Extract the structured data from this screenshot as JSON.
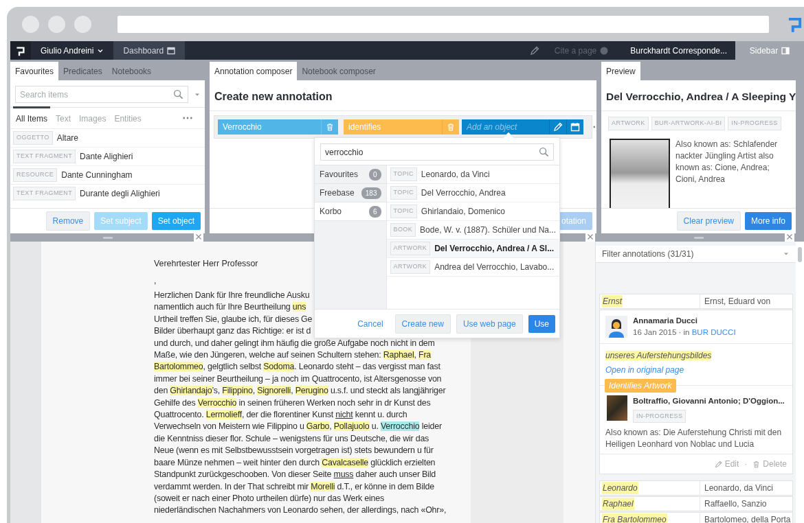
{
  "navbar": {
    "user": "Giulio Andreini",
    "dashboard": "Dashboard",
    "cite": {
      "label": "Cite a page",
      "disabled": true
    },
    "document": "Burckhardt Corresponde...",
    "sidebar": "Sidebar"
  },
  "left_panel": {
    "tabs": [
      {
        "label": "Favourites",
        "selected": true
      },
      {
        "label": "Predicates",
        "selected": false
      },
      {
        "label": "Notebooks",
        "selected": false
      }
    ],
    "search": {
      "placeholder": "Search items"
    },
    "filters": [
      {
        "label": "All Items",
        "selected": true
      },
      {
        "label": "Text",
        "selected": false
      },
      {
        "label": "Images",
        "selected": false
      },
      {
        "label": "Entities",
        "selected": false
      }
    ],
    "items": [
      {
        "type": "OGGETTO",
        "label": "Altare"
      },
      {
        "type": "TEXT FRAGMENT",
        "label": "Dante Alighieri"
      },
      {
        "type": "RESOURCE",
        "label": "Dante Cunningham"
      },
      {
        "type": "TEXT FRAGMENT",
        "label": "Durante degli Alighieri"
      }
    ],
    "buttons": [
      {
        "label": "Remove",
        "kind": "default",
        "disabled": false
      },
      {
        "label": "Set subject",
        "kind": "bright",
        "disabled": true
      },
      {
        "label": "Set object",
        "kind": "bright",
        "disabled": false
      }
    ]
  },
  "composer": {
    "tabs": [
      {
        "label": "Annotation composer",
        "selected": true
      },
      {
        "label": "Notebook composer",
        "selected": false
      }
    ],
    "title": "Create new annotation",
    "subject": "Verrocchio",
    "predicate": "identifies",
    "object": {
      "placeholder": "Add an object"
    },
    "button": "otation"
  },
  "preview": {
    "tabs": [
      {
        "label": "Preview",
        "selected": true
      }
    ],
    "title": "Del Verrocchio, Andrea / A Sleeping Y",
    "tags": [
      "ARTWORK",
      "BUR-ARTWORK-AI-BI",
      "IN-PROGRESS"
    ],
    "description": "Also known as: Schlafender nackter Jüngling Artist also known as: Cione, Andrea; Cioni, Andrea",
    "buttons": [
      {
        "label": "Clear preview",
        "kind": "default",
        "disabled": false
      },
      {
        "label": "More info",
        "kind": "primary",
        "disabled": false
      }
    ]
  },
  "letter": {
    "salutation": "Verehrtester Herr Professor",
    "comma": ",",
    "lines": [
      [
        {
          "kind": "plain",
          "text": "Herzlichen Dank für Ihre freundliche Ausku"
        }
      ],
      [
        {
          "kind": "plain",
          "text": "namentlich auch für Ihre Beurtheilung "
        },
        {
          "kind": "highlight",
          "text": "uns",
          "color": "#fcf7a5"
        }
      ],
      [
        {
          "kind": "plain",
          "text": "Urtheil treffen Sie, glaube ich, für dieses Ge"
        }
      ],
      [
        {
          "kind": "plain",
          "text": "Bilder überhaupt ganz das Richtige: er ist d"
        }
      ],
      [
        {
          "kind": "plain",
          "text": "und durch, und daher gelingt ihm häufig die große Aufgabe noch nicht in dem"
        }
      ],
      [
        {
          "kind": "plain",
          "text": "Maße, wie den Jüngeren, welche auf seinen Schultern stehen: "
        },
        {
          "kind": "highlight",
          "text": "Raphael",
          "color": "#fcf7a5"
        },
        {
          "kind": "plain",
          "text": ", "
        },
        {
          "kind": "highlight",
          "text": "Fra",
          "color": "#fcf7a5"
        }
      ],
      [
        {
          "kind": "highlight",
          "text": "Bartolommeo",
          "color": "#fcf7a5"
        },
        {
          "kind": "plain",
          "text": ", gelgtlich selbst "
        },
        {
          "kind": "highlight",
          "text": "Sodoma",
          "color": "#fcf7a5"
        },
        {
          "kind": "plain",
          "text": ". Leonardo steht – das vergisst man fast"
        }
      ],
      [
        {
          "kind": "plain",
          "text": "immer bei seiner Beurtheilung – ja noch im Quattrocento, ist Altersgenosse von"
        }
      ],
      [
        {
          "kind": "plain",
          "text": "den "
        },
        {
          "kind": "highlight",
          "text": "Ghirlandajo",
          "color": "#fcf7a5"
        },
        {
          "kind": "plain",
          "text": "’s, "
        },
        {
          "kind": "highlight",
          "text": "Filippino",
          "color": "#fcf7a5"
        },
        {
          "kind": "plain",
          "text": ", "
        },
        {
          "kind": "highlight",
          "text": "Signorelli",
          "color": "#fcf7a5"
        },
        {
          "kind": "plain",
          "text": ", "
        },
        {
          "kind": "highlight",
          "text": "Perugino",
          "color": "#fcf7a5"
        },
        {
          "kind": "plain",
          "text": " u.s.f. und steckt als langjähriger"
        }
      ],
      [
        {
          "kind": "plain",
          "text": "Gehilfe des "
        },
        {
          "kind": "highlight",
          "text": "Verrocchio",
          "color": "#fcf7a5"
        },
        {
          "kind": "plain",
          "text": " in seinen früheren Werken noch sehr in dr Kunst des"
        }
      ],
      [
        {
          "kind": "plain",
          "text": "Quattrocento. "
        },
        {
          "kind": "highlight",
          "text": "Lermolieff",
          "color": "#fcf7a5"
        },
        {
          "kind": "plain",
          "text": ", der die florentiner Kunst "
        },
        {
          "kind": "underline",
          "text": "nicht"
        },
        {
          "kind": "plain",
          "text": " kennt u. durch"
        }
      ],
      [
        {
          "kind": "plain",
          "text": "Verwechseln von Meistern wie Filippino u "
        },
        {
          "kind": "highlight",
          "text": "Garbo",
          "color": "#fcf7a5"
        },
        {
          "kind": "plain",
          "text": ", "
        },
        {
          "kind": "highlight",
          "text": "Pollajuolo",
          "color": "#fcf7a5"
        },
        {
          "kind": "plain",
          "text": " u. "
        },
        {
          "kind": "highlight",
          "text": "Verrocchio",
          "color": "#a6ecec"
        },
        {
          "kind": "plain",
          "text": " leider"
        }
      ],
      [
        {
          "kind": "plain",
          "text": "die Kenntniss dieser flor. Schule – wenigstens für uns Deutsche, die wir das"
        }
      ],
      [
        {
          "kind": "plain",
          "text": "Neue (wenn es mit Selbstbewusstsein vorgetragen ist) stets bewundern u für"
        }
      ],
      [
        {
          "kind": "plain",
          "text": "baare Münze nehmen – weit hinter den durch "
        },
        {
          "kind": "highlight",
          "text": "Cavalcaselle",
          "color": "#fcf7a5"
        },
        {
          "kind": "plain",
          "text": " glücklich erzielten"
        }
      ],
      [
        {
          "kind": "plain",
          "text": "Standpunkt zurückgeschooben. Von dieser Seite "
        },
        {
          "kind": "underline",
          "text": "muss"
        },
        {
          "kind": "plain",
          "text": " daher auch unser Bild"
        }
      ],
      [
        {
          "kind": "plain",
          "text": "verdammt werden. In der That schreibt mir "
        },
        {
          "kind": "highlight",
          "text": "Morelli",
          "color": "#fcf7a5"
        },
        {
          "kind": "plain",
          "text": " d.T., er könne in dem Bilde"
        }
      ],
      [
        {
          "kind": "plain",
          "text": "(soweit er nach einer Photo urtheilen dürfe) nur das Werk eines"
        }
      ],
      [
        {
          "kind": "plain",
          "text": "niederländischen Nachahmers von Leonardo sehen, der allerdings, nach «Ohr»,"
        }
      ]
    ]
  },
  "dropdown": {
    "query": "verrocchio",
    "sources": [
      {
        "label": "Favourites",
        "count": "0",
        "selected": false
      },
      {
        "label": "Freebase",
        "count": "183",
        "selected": false
      },
      {
        "label": "Korbo",
        "count": "6",
        "selected": true
      }
    ],
    "results": [
      {
        "type": "TOPIC",
        "label": "Leonardo, da Vinci",
        "selected": false
      },
      {
        "type": "TOPIC",
        "label": "Del Verrocchio, Andrea",
        "selected": false
      },
      {
        "type": "TOPIC",
        "label": "Ghirlandaio, Domenico",
        "selected": false
      },
      {
        "type": "BOOK",
        "label": "Bode, W. v. (1887). Schüler und Na...",
        "selected": false
      },
      {
        "type": "ARTWORK",
        "label": "Del Verrocchio, Andrea / A Sl...",
        "selected": true
      },
      {
        "type": "ARTWORK",
        "label": "Andrea del Verrocchio, Lavabo...",
        "selected": false
      }
    ],
    "buttons": [
      {
        "label": "Cancel",
        "kind": "link",
        "disabled": false
      },
      {
        "label": "Create new",
        "kind": "default",
        "disabled": false
      },
      {
        "label": "Use web page",
        "kind": "default",
        "disabled": false
      },
      {
        "label": "Use",
        "kind": "primary",
        "disabled": false
      }
    ]
  },
  "sidebar": {
    "filter": "Filter annotations (31/31)",
    "annotations": [
      {
        "kind": "row",
        "text": "Ernst",
        "entity": "Ernst, Eduard von"
      },
      {
        "kind": "card",
        "author": "Annamaria Ducci",
        "date": "16 Jan 2015 · in",
        "notebook": "BUR DUCCI",
        "quote": "unseres Auferstehungsbildes",
        "link": "Open in original page",
        "predicate": "Identifies Artwork",
        "object_title": "Boltraffio, Giovanni Antonio; D'Oggion...",
        "object_tag": "IN-PROGRESS",
        "object_description": "Also known as: Die Auferstehung Christi mit den Heiligen Leonhard von Noblac und Lucia",
        "edit": "Edit",
        "separator": "·",
        "delete": "Delete"
      },
      {
        "kind": "row",
        "text": "Leonardo",
        "entity": "Leonardo, da Vinci"
      },
      {
        "kind": "row",
        "text": "Raphael",
        "entity": "Raffaello, Sanzio"
      },
      {
        "kind": "row",
        "text": "Fra Bartolommeo",
        "entity": "Bartolomeo, della Porta"
      }
    ]
  }
}
